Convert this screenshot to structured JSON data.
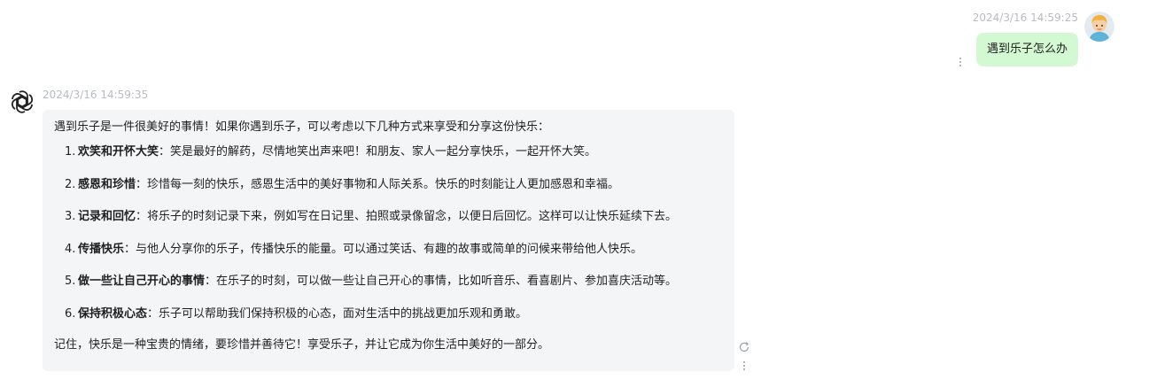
{
  "user_message": {
    "timestamp": "2024/3/16 14:59:25",
    "text": "遇到乐子怎么办",
    "avatar_icon": "user-avatar-icon",
    "bubble_color": "#d2f9d1"
  },
  "assistant_message": {
    "timestamp": "2024/3/16 14:59:35",
    "avatar_icon": "openai-logo-icon",
    "intro": "遇到乐子是一件很美好的事情！如果你遇到乐子，可以考虑以下几种方式来享受和分享这份快乐：",
    "items": [
      {
        "num": "1.",
        "title": "欢笑和开怀大笑",
        "sep": "：",
        "text": "笑是最好的解药，尽情地笑出声来吧！和朋友、家人一起分享快乐，一起开怀大笑。"
      },
      {
        "num": "2.",
        "title": "感恩和珍惜",
        "sep": "：",
        "text": "珍惜每一刻的快乐，感恩生活中的美好事物和人际关系。快乐的时刻能让人更加感恩和幸福。"
      },
      {
        "num": "3.",
        "title": "记录和回忆",
        "sep": "：",
        "text": "将乐子的时刻记录下来，例如写在日记里、拍照或录像留念，以便日后回忆。这样可以让快乐延续下去。"
      },
      {
        "num": "4.",
        "title": "传播快乐",
        "sep": "：",
        "text": "与他人分享你的乐子，传播快乐的能量。可以通过笑话、有趣的故事或简单的问候来带给他人快乐。"
      },
      {
        "num": "5.",
        "title": "做一些让自己开心的事情",
        "sep": "：",
        "text": "在乐子的时刻，可以做一些让自己开心的事情，比如听音乐、看喜剧片、参加喜庆活动等。"
      },
      {
        "num": "6.",
        "title": "保持积极心态",
        "sep": "：",
        "text": "乐子可以帮助我们保持积极的心态，面对生活中的挑战更加乐观和勇敢。"
      }
    ],
    "outro": "记住，快乐是一种宝贵的情绪，要珍惜并善待它！享受乐子，并让它成为你生活中美好的一部分。",
    "bubble_color": "#f4f5f7"
  },
  "icons": {
    "regenerate": "refresh-icon",
    "more": "more-vertical-icon"
  }
}
